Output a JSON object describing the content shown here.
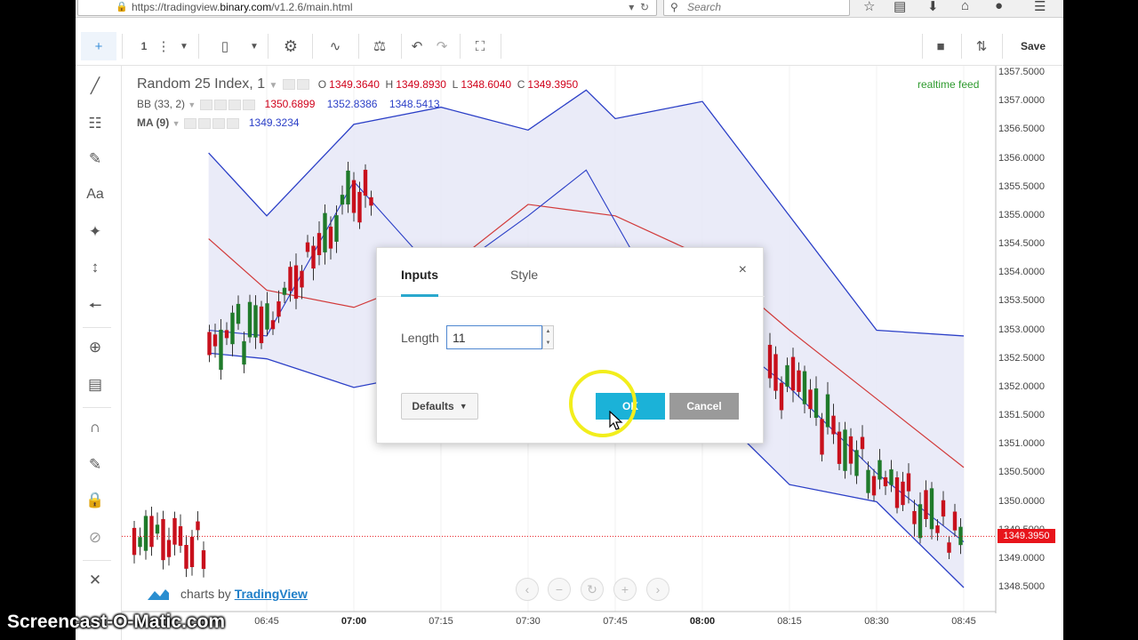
{
  "browser": {
    "url_prefix": "https://tradingview.",
    "url_domain": "binary.com",
    "url_suffix": "/v1.2.6/main.html",
    "search_placeholder": "Search"
  },
  "toolbar": {
    "interval": "1",
    "save_label": "Save"
  },
  "legend": {
    "symbol": "Random 25 Index, 1",
    "o_label": "O",
    "o_value": "1349.3640",
    "h_label": "H",
    "h_value": "1349.8930",
    "l_label": "L",
    "l_value": "1348.6040",
    "c_label": "C",
    "c_value": "1349.3950",
    "bb_label": "BB (33, 2)",
    "bb_values": [
      "1350.6899",
      "1352.8386",
      "1348.5413"
    ],
    "ma_label": "MA (9)",
    "ma_value": "1349.3234"
  },
  "realtime_label": "realtime feed",
  "price_axis": [
    "1357.5000",
    "1357.0000",
    "1356.5000",
    "1356.0000",
    "1355.5000",
    "1355.0000",
    "1354.5000",
    "1354.0000",
    "1353.5000",
    "1353.0000",
    "1352.5000",
    "1352.0000",
    "1351.5000",
    "1351.0000",
    "1350.5000",
    "1350.0000",
    "1349.5000",
    "1349.0000",
    "1348.5000"
  ],
  "current_price": "1349.3950",
  "time_axis": [
    {
      "label": "06:45",
      "bold": false
    },
    {
      "label": "07:00",
      "bold": true
    },
    {
      "label": "07:15",
      "bold": false
    },
    {
      "label": "07:30",
      "bold": false
    },
    {
      "label": "07:45",
      "bold": false
    },
    {
      "label": "08:00",
      "bold": true
    },
    {
      "label": "08:15",
      "bold": false
    },
    {
      "label": "08:30",
      "bold": false
    },
    {
      "label": "08:45",
      "bold": false
    }
  ],
  "watermark": {
    "prefix": "charts by",
    "brand": "TradingView"
  },
  "dialog": {
    "tab_inputs": "Inputs",
    "tab_style": "Style",
    "close": "×",
    "length_label": "Length",
    "length_value": "11",
    "defaults_label": "Defaults",
    "ok_label": "OK",
    "cancel_label": "Cancel"
  },
  "screencast_label": "Screencast-O-Matic.com",
  "colors": {
    "bullish": "#1f7a2a",
    "bearish": "#c8101c",
    "bb_band": "#2b3fc7",
    "bb_fill": "#e6e8f7",
    "bb_mid": "#d23a3a",
    "ma": "#2b3fc7",
    "accent": "#1bb2d8"
  },
  "chart_data": {
    "type": "candlestick",
    "series": [
      {
        "name": "BB (33, 2) upper",
        "x": [
          "06:35",
          "06:45",
          "07:00",
          "07:15",
          "07:30",
          "07:40",
          "07:45",
          "08:00",
          "08:15",
          "08:30",
          "08:45"
        ],
        "values": [
          1356.1,
          1355.0,
          1356.6,
          1356.9,
          1356.5,
          1357.2,
          1356.7,
          1357.0,
          1355.0,
          1353.0,
          1352.9
        ]
      },
      {
        "name": "BB (33, 2) basis",
        "x": [
          "06:35",
          "06:45",
          "07:00",
          "07:15",
          "07:30",
          "07:45",
          "08:00",
          "08:15",
          "08:30",
          "08:45"
        ],
        "values": [
          1354.6,
          1353.7,
          1353.4,
          1354.0,
          1355.2,
          1355.0,
          1354.3,
          1353.0,
          1351.8,
          1350.6
        ]
      },
      {
        "name": "BB (33, 2) lower",
        "x": [
          "06:35",
          "06:45",
          "07:00",
          "07:15",
          "07:30",
          "07:45",
          "08:00",
          "08:15",
          "08:30",
          "08:45"
        ],
        "values": [
          1352.6,
          1352.5,
          1352.0,
          1352.3,
          1352.4,
          1352.6,
          1351.8,
          1350.3,
          1350.0,
          1348.5
        ]
      },
      {
        "name": "MA (9)",
        "x": [
          "06:35",
          "06:45",
          "07:00",
          "07:15",
          "07:30",
          "07:40",
          "07:50",
          "08:15",
          "08:30",
          "08:45"
        ],
        "values": [
          1353.0,
          1352.9,
          1355.6,
          1353.9,
          1355.0,
          1355.8,
          1354.0,
          1352.0,
          1350.5,
          1349.3
        ]
      }
    ],
    "ylim": [
      1348.3,
      1357.7
    ],
    "last_close": 1349.395
  }
}
